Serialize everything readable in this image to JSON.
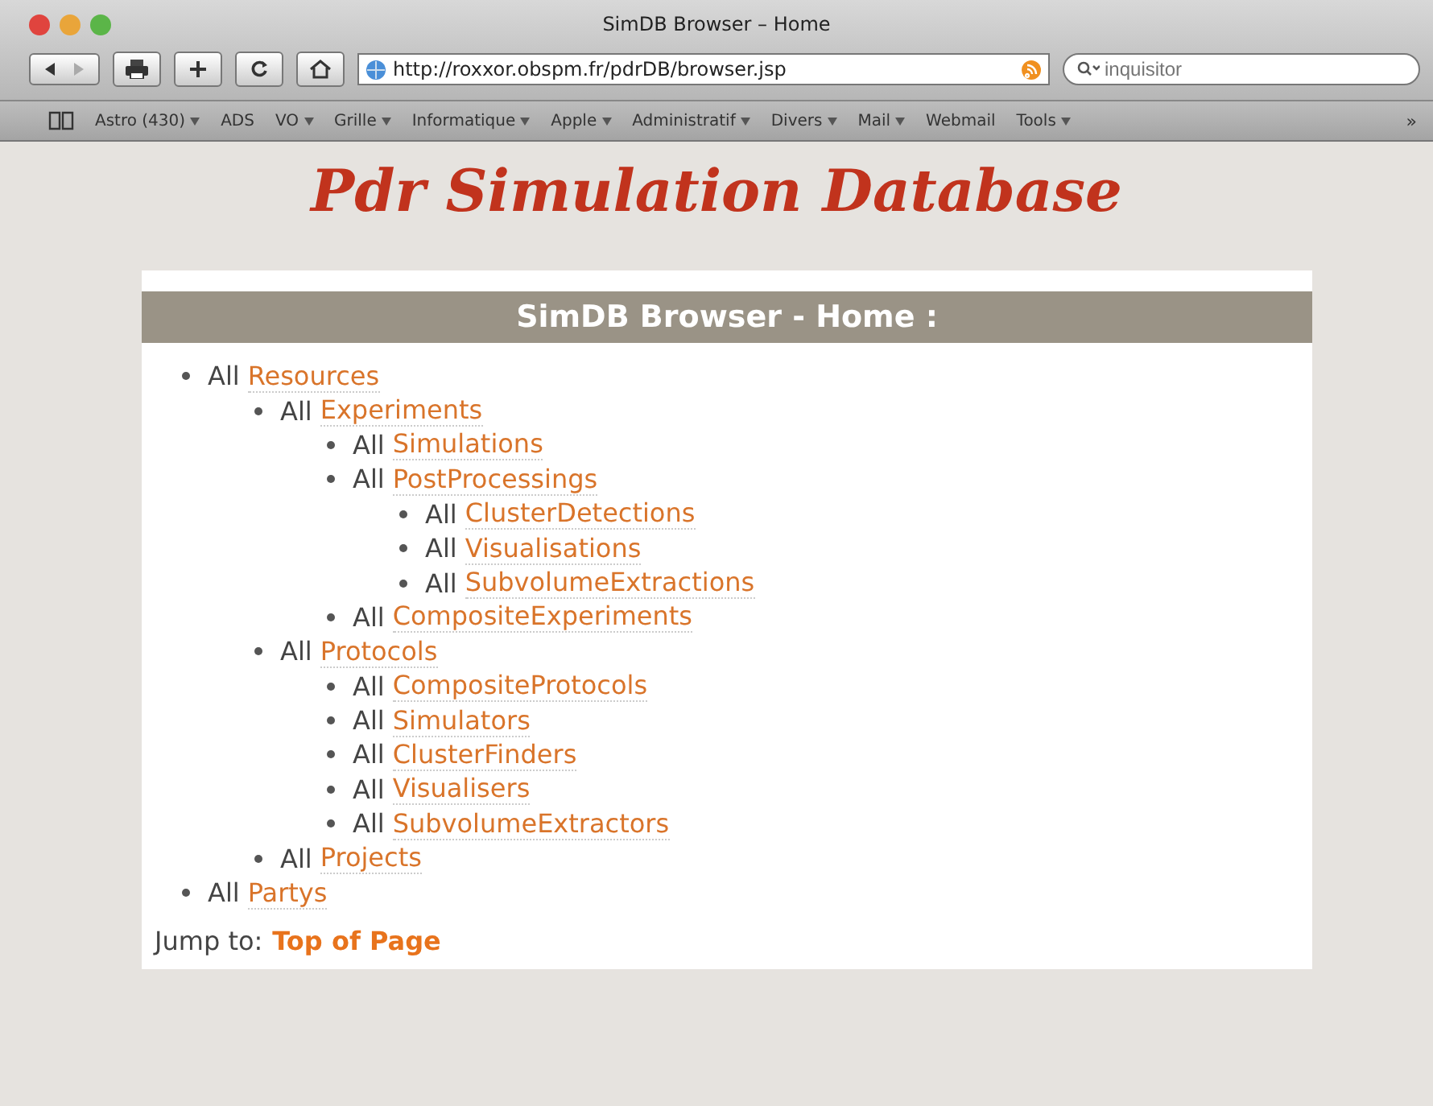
{
  "window": {
    "title": "SimDB Browser – Home"
  },
  "toolbar": {
    "url": "http://roxxor.obspm.fr/pdrDB/browser.jsp",
    "search": {
      "placeholder": "inquisitor"
    }
  },
  "bookmarks": [
    {
      "label": "Astro (430)",
      "menu": true
    },
    {
      "label": "ADS",
      "menu": false
    },
    {
      "label": "VO",
      "menu": true
    },
    {
      "label": "Grille",
      "menu": true
    },
    {
      "label": "Informatique",
      "menu": true
    },
    {
      "label": "Apple",
      "menu": true
    },
    {
      "label": "Administratif",
      "menu": true
    },
    {
      "label": "Divers",
      "menu": true
    },
    {
      "label": "Mail",
      "menu": true
    },
    {
      "label": "Webmail",
      "menu": false
    },
    {
      "label": "Tools",
      "menu": true
    }
  ],
  "bookmarks_more": "»",
  "page": {
    "heading": "Pdr Simulation Database",
    "panel_title": "SimDB Browser - Home :",
    "tree": [
      {
        "prefix": "All",
        "link": "Resources",
        "children": [
          {
            "prefix": "All",
            "link": "Experiments",
            "children": [
              {
                "prefix": "All",
                "link": "Simulations"
              },
              {
                "prefix": "All",
                "link": "PostProcessings",
                "children": [
                  {
                    "prefix": "All",
                    "link": "ClusterDetections"
                  },
                  {
                    "prefix": "All",
                    "link": "Visualisations"
                  },
                  {
                    "prefix": "All",
                    "link": "SubvolumeExtractions"
                  }
                ]
              },
              {
                "prefix": "All",
                "link": "CompositeExperiments"
              }
            ]
          },
          {
            "prefix": "All",
            "link": "Protocols",
            "children": [
              {
                "prefix": "All",
                "link": "CompositeProtocols"
              },
              {
                "prefix": "All",
                "link": "Simulators"
              },
              {
                "prefix": "All",
                "link": "ClusterFinders"
              },
              {
                "prefix": "All",
                "link": "Visualisers"
              },
              {
                "prefix": "All",
                "link": "SubvolumeExtractors"
              }
            ]
          },
          {
            "prefix": "All",
            "link": "Projects"
          }
        ]
      },
      {
        "prefix": "All",
        "link": "Partys"
      }
    ],
    "jump_label": "Jump to:",
    "jump_link": "Top of Page"
  }
}
